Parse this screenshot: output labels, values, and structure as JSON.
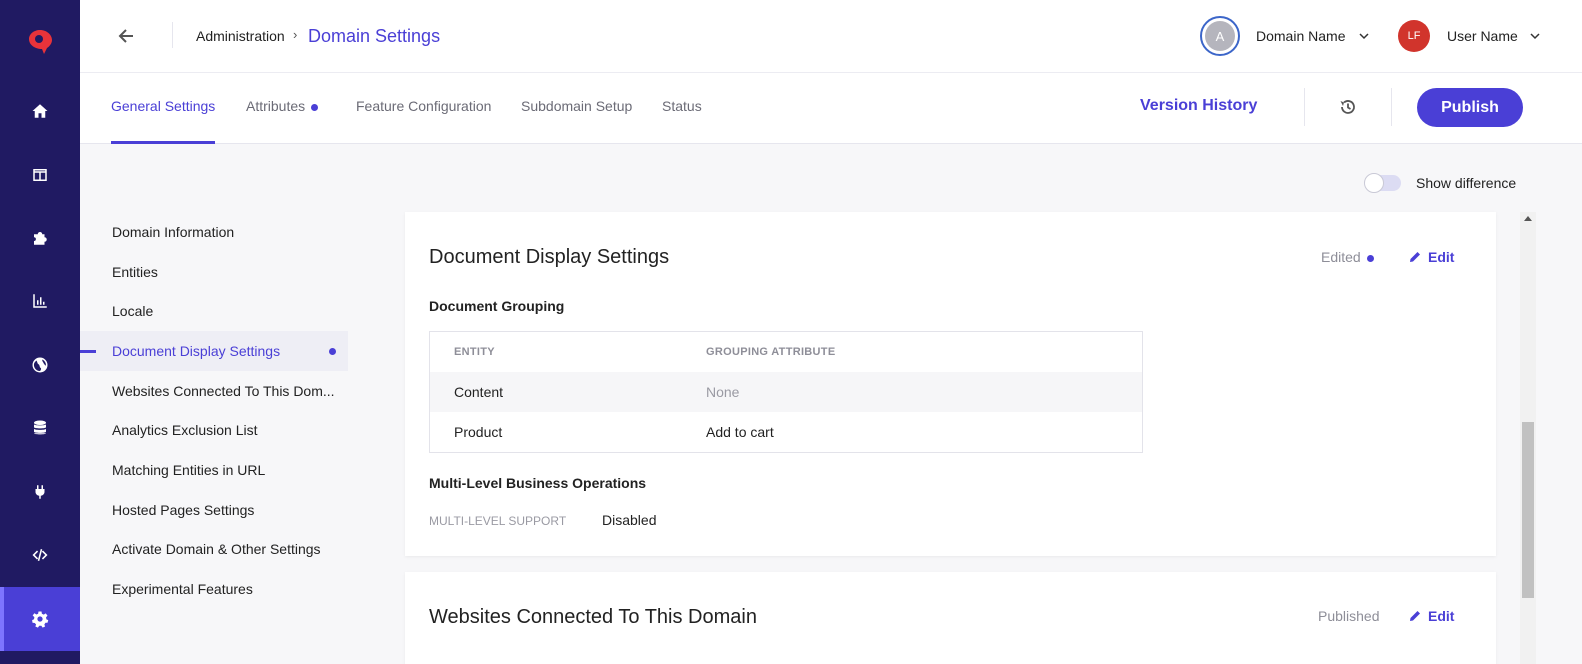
{
  "header": {
    "breadcrumb_parent": "Administration",
    "breadcrumb_separator": "›",
    "breadcrumb_current": "Domain Settings",
    "domain_avatar_initial": "A",
    "domain_name": "Domain Name",
    "user_initials": "LF",
    "user_name": "User Name"
  },
  "rail": {
    "icons": [
      "brand-logo-icon",
      "home-icon",
      "layout-icon",
      "puzzle-icon",
      "chart-icon",
      "globe-icon",
      "database-icon",
      "plug-icon",
      "code-icon",
      "gear-icon"
    ],
    "active": "gear-icon"
  },
  "tabs": {
    "general": "General Settings",
    "attributes": "Attributes",
    "feature_config": "Feature Configuration",
    "subdomain": "Subdomain Setup",
    "status": "Status",
    "version_history": "Version History",
    "publish": "Publish"
  },
  "toggle": {
    "label": "Show difference",
    "checked": false
  },
  "sidemenu": {
    "items": [
      "Domain Information",
      "Entities",
      "Locale",
      "Document Display Settings",
      "Websites Connected To This Dom...",
      "Analytics Exclusion List",
      "Matching Entities in URL",
      "Hosted Pages Settings",
      "Activate Domain & Other Settings",
      "Experimental Features"
    ],
    "active_index": 3
  },
  "card1": {
    "title": "Document Display Settings",
    "status": "Edited",
    "edit": "Edit",
    "grouping_heading": "Document Grouping",
    "table": {
      "headers": [
        "ENTITY",
        "GROUPING ATTRIBUTE"
      ],
      "rows": [
        [
          "Content",
          "None"
        ],
        [
          "Product",
          "Add to cart"
        ]
      ]
    },
    "multi_heading": "Multi-Level Business Operations",
    "multi_label": "MULTI-LEVEL SUPPORT",
    "multi_value": "Disabled"
  },
  "card2": {
    "title": "Websites Connected To This Domain",
    "status": "Published",
    "edit": "Edit"
  },
  "colors": {
    "accent": "#4a3fd6",
    "rail": "#201a62",
    "user_avatar": "#d1342c"
  }
}
